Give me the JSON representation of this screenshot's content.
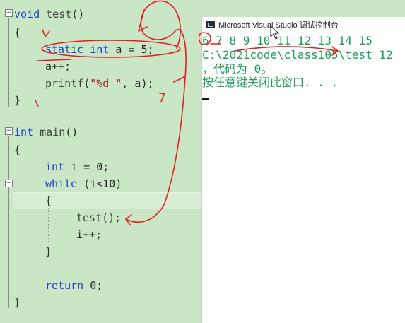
{
  "code": {
    "fn_test_decl": [
      "void",
      "test",
      "()"
    ],
    "open_brace_1": "{",
    "static_line": [
      "static",
      "int",
      "a = ",
      "5",
      ";"
    ],
    "a_inc": "a++;",
    "printf_line": [
      "printf",
      "(",
      "\"%d \"",
      ", a);"
    ],
    "close_brace_1": "}",
    "fn_main_decl": [
      "int",
      "main",
      "()"
    ],
    "open_brace_2": "{",
    "int_i_line": [
      "int",
      "i = ",
      "0",
      ";"
    ],
    "while_line": [
      "while",
      " (i<10)"
    ],
    "open_brace_3": "{",
    "call_test": "test();",
    "i_inc": "i++;",
    "close_brace_3": "}",
    "return_line": [
      "return",
      " 0;"
    ],
    "close_brace_2": "}"
  },
  "console": {
    "title": "Microsoft Visual Studio 调试控制台",
    "output_numbers": "6 7 8 9 10 11 12 13 14 15",
    "path_line": "C:\\2021code\\class105\\test_12_",
    "exit_line": "，代码为 0。",
    "press_key_line": "按任意键关闭此窗口. . ."
  },
  "annotations": {
    "ink_color": "#e02020",
    "handwritten_seven": "7"
  },
  "colors": {
    "editor_bg": "#c9e6c5",
    "keyword": "#1f3fd1",
    "console_text": "#1f9e55"
  }
}
